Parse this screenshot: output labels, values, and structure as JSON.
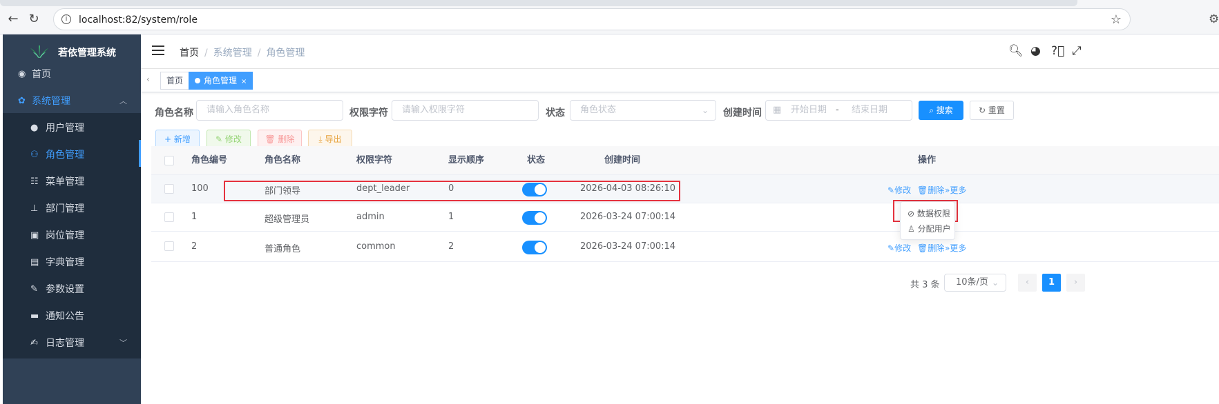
{
  "browser": {
    "url": "localhost:82/system/role"
  },
  "app": {
    "title": "若依管理系统"
  },
  "sidebar": {
    "items": [
      {
        "label": "首页",
        "icon": "dashboard-icon"
      },
      {
        "label": "系统管理",
        "icon": "gear-icon"
      },
      {
        "label": "用户管理",
        "icon": "user-icon"
      },
      {
        "label": "角色管理",
        "icon": "peoples-icon"
      },
      {
        "label": "菜单管理",
        "icon": "tree-table-icon"
      },
      {
        "label": "部门管理",
        "icon": "tree-icon"
      },
      {
        "label": "岗位管理",
        "icon": "post-icon"
      },
      {
        "label": "字典管理",
        "icon": "dict-icon"
      },
      {
        "label": "参数设置",
        "icon": "edit-icon"
      },
      {
        "label": "通知公告",
        "icon": "message-icon"
      },
      {
        "label": "日志管理",
        "icon": "log-icon"
      }
    ]
  },
  "header": {
    "breadcrumb": [
      "首页",
      "系统管理",
      "角色管理"
    ]
  },
  "tags": [
    {
      "label": "首页"
    },
    {
      "label": "角色管理"
    }
  ],
  "search": {
    "role_name_label": "角色名称",
    "role_name_placeholder": "请输入角色名称",
    "role_key_label": "权限字符",
    "role_key_placeholder": "请输入权限字符",
    "status_label": "状态",
    "status_placeholder": "角色状态",
    "date_label": "创建时间",
    "start_placeholder": "开始日期",
    "date_sep": "-",
    "end_placeholder": "结束日期",
    "search_btn": "搜索",
    "reset_btn": "重置"
  },
  "toolbar": {
    "add": "新增",
    "edit": "修改",
    "delete": "删除",
    "export": "导出"
  },
  "table": {
    "headers": [
      "角色编号",
      "角色名称",
      "权限字符",
      "显示顺序",
      "状态",
      "创建时间",
      "操作"
    ],
    "rows": [
      {
        "id": "100",
        "name": "部门领导",
        "key": "dept_leader",
        "sort": "0",
        "status_on": true,
        "created": "2026-04-03 08:26:10"
      },
      {
        "id": "1",
        "name": "超级管理员",
        "key": "admin",
        "sort": "1",
        "status_on": true,
        "created": "2026-03-24 07:00:14"
      },
      {
        "id": "2",
        "name": "普通角色",
        "key": "common",
        "sort": "2",
        "status_on": true,
        "created": "2026-03-24 07:00:14"
      }
    ],
    "op_edit": "修改",
    "op_delete": "删除",
    "op_more": "更多"
  },
  "dropdown": {
    "items": [
      "数据权限",
      "分配用户"
    ]
  },
  "pagination": {
    "total": "共 3 条",
    "page_size": "10条/页",
    "current_page": "1"
  },
  "colors": {
    "sidebar_bg": "#304156",
    "primary": "#1890ff",
    "highlight_box": "#e5323e"
  }
}
